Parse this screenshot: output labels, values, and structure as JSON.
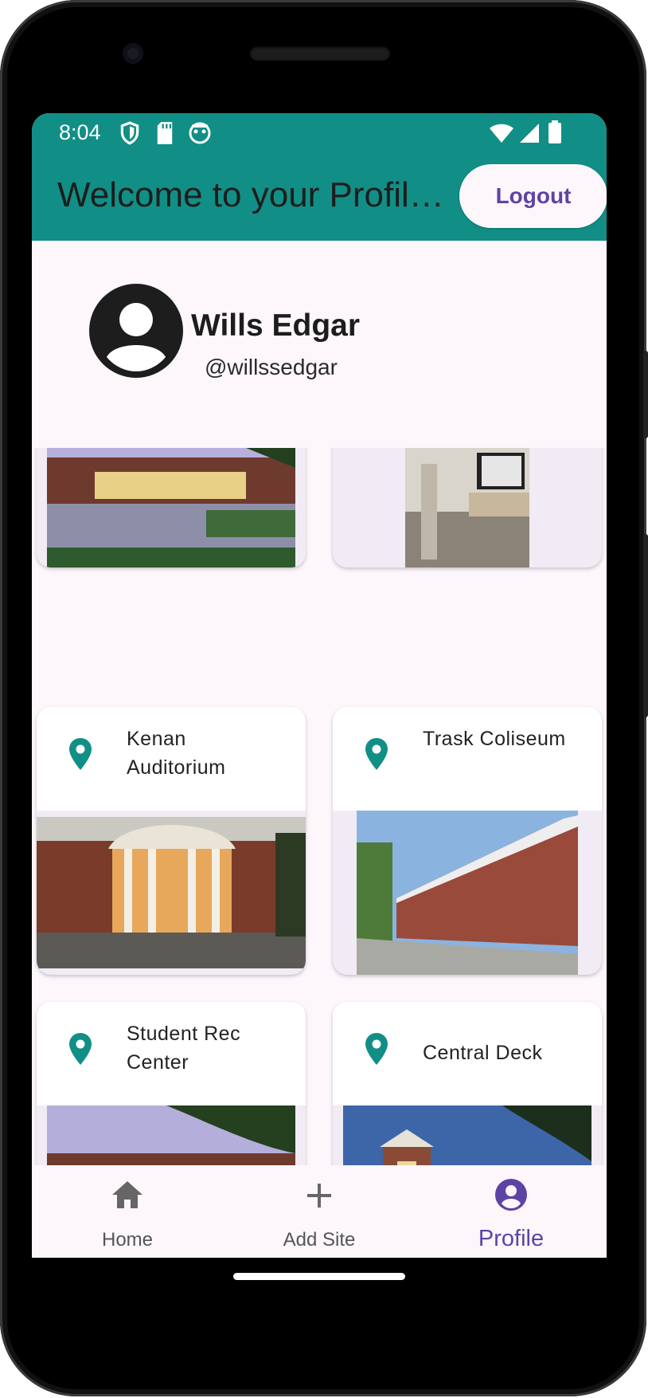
{
  "status_bar": {
    "time": "8:04"
  },
  "app_bar": {
    "title": "Welcome to your Profil…",
    "logout_label": "Logout"
  },
  "profile": {
    "name": "Wills Edgar",
    "handle": "@willssedgar"
  },
  "sites": [
    {
      "label": ""
    },
    {
      "label": ""
    },
    {
      "label": "Kenan Auditorium"
    },
    {
      "label": "Trask Coliseum"
    },
    {
      "label": "Student Rec Center"
    },
    {
      "label": "Central Deck"
    }
  ],
  "nav": [
    {
      "label": "Home",
      "icon": "home-icon"
    },
    {
      "label": "Add Site",
      "icon": "add-icon"
    },
    {
      "label": "Profile",
      "icon": "account-circle-icon",
      "active": true
    }
  ],
  "colors": {
    "app_bar": "#118f86",
    "accent": "#5d43a5",
    "pin": "#118f86",
    "surface": "#fdf7fc"
  }
}
